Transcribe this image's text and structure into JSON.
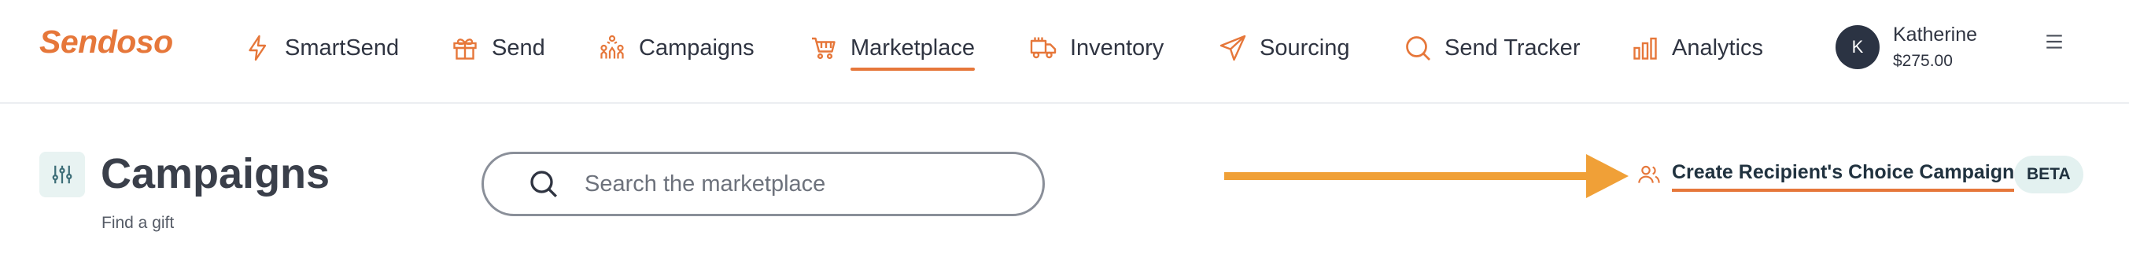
{
  "brand": {
    "name": "Sendoso",
    "accent": "#e6773a"
  },
  "nav": [
    {
      "label": "SmartSend",
      "icon": "bolt-icon"
    },
    {
      "label": "Send",
      "icon": "gift-icon"
    },
    {
      "label": "Campaigns",
      "icon": "campaign-people-icon"
    },
    {
      "label": "Marketplace",
      "icon": "cart-icon",
      "active": true
    },
    {
      "label": "Inventory",
      "icon": "truck-icon"
    },
    {
      "label": "Sourcing",
      "icon": "paper-plane-icon"
    },
    {
      "label": "Send Tracker",
      "icon": "search-icon"
    },
    {
      "label": "Analytics",
      "icon": "bar-chart-icon"
    }
  ],
  "user": {
    "initial": "K",
    "name": "Katherine",
    "balance": "$275.00"
  },
  "page": {
    "title": "Campaigns",
    "subtitle": "Find a gift"
  },
  "search": {
    "placeholder": "Search the marketplace",
    "value": ""
  },
  "recipient_choice": {
    "label": "Create Recipient's Choice Campaign",
    "badge": "BETA"
  },
  "colors": {
    "arrow": "#f0a037",
    "underline": "#e6773a",
    "avatar": "#2b3343",
    "badge_bg": "#e3f1f0"
  }
}
